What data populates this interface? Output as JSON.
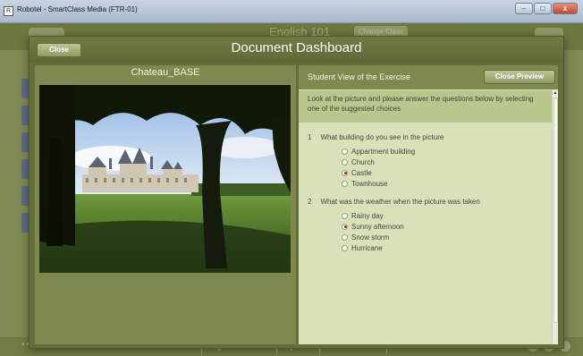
{
  "window": {
    "title": "Robotel - SmartClass Media (FTR-01)",
    "buttons": {
      "minimize": "–",
      "maximize": "□",
      "close": "x"
    }
  },
  "background_app": {
    "course_title": "English 101",
    "change_class": "Change Class",
    "bottom_nav": [
      "Add Document",
      "Organize Exercises",
      "My Class",
      "Add Student"
    ],
    "bottom_dots": "••••••••••"
  },
  "dialog": {
    "title": "Document Dashboard",
    "close_label": "Close",
    "document_name": "Chateau_BASE",
    "preview": {
      "header": "Student View of the Exercise",
      "close_preview_label": "Close Preview",
      "instructions": "Look at the picture and please answer the questions below by selecting one of the suggested choices",
      "questions": [
        {
          "number": "1",
          "text": "What building do you see in the picture",
          "options": [
            {
              "label": "Appartment building",
              "checked": false
            },
            {
              "label": "Church",
              "checked": false
            },
            {
              "label": "Castle",
              "checked": true
            },
            {
              "label": "Townhouse",
              "checked": false
            }
          ]
        },
        {
          "number": "2",
          "text": "What was the weather when the picture was taken",
          "options": [
            {
              "label": "Rainy day",
              "checked": false
            },
            {
              "label": "Sunny afternoon",
              "checked": true
            },
            {
              "label": "Snow storm",
              "checked": false
            },
            {
              "label": "Hurricane",
              "checked": false
            }
          ]
        }
      ]
    }
  },
  "colors": {
    "accent_olive": "#636f3a",
    "panel_olive": "#7d894f",
    "preview_bg": "#d8e2b8",
    "instructions_bg": "#b8c78c"
  }
}
